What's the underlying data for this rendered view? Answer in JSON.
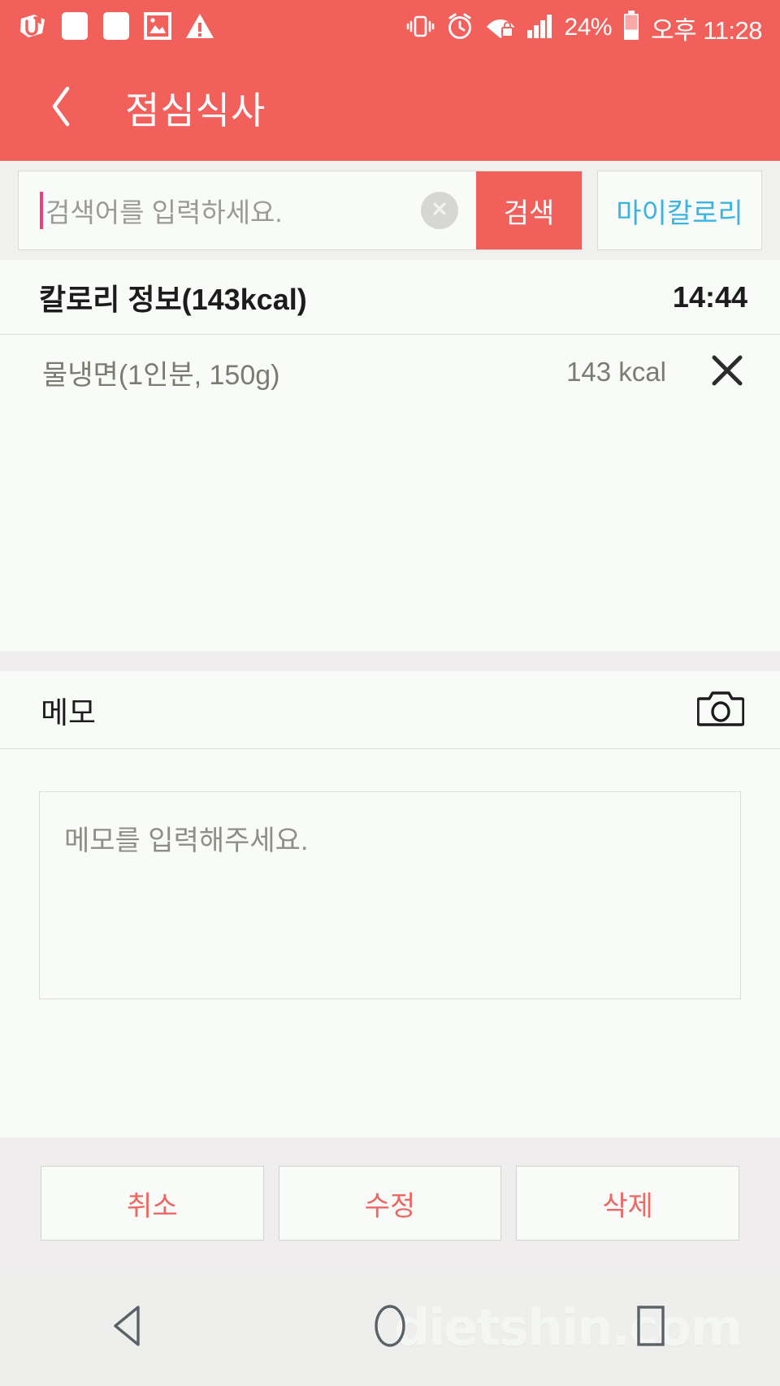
{
  "status_bar": {
    "icons_left": [
      "u-plus-icon",
      "blank-square-icon",
      "blank-square-icon",
      "photo-icon",
      "warning-icon"
    ],
    "icons_right": [
      "vibrate-icon",
      "alarm-icon",
      "wifi-lock-icon",
      "signal-icon"
    ],
    "battery_percent": "24%",
    "clock": "오후 11:28"
  },
  "app_bar": {
    "back_icon": "chevron-left-icon",
    "title": "점심식사"
  },
  "search": {
    "placeholder": "검색어를 입력하세요.",
    "value": "",
    "clear_icon": "clear-circle-icon",
    "search_label": "검색",
    "mycalorie_label": "마이칼로리"
  },
  "calorie": {
    "title": "칼로리 정보(143kcal)",
    "time": "14:44",
    "items": [
      {
        "name": "물냉면(1인분, 150g)",
        "kcal": "143 kcal",
        "delete_icon": "close-x-icon"
      }
    ]
  },
  "memo": {
    "label": "메모",
    "camera_icon": "camera-icon",
    "placeholder": "메모를 입력해주세요.",
    "value": ""
  },
  "actions": {
    "cancel_label": "취소",
    "edit_label": "수정",
    "delete_label": "삭제"
  },
  "nav_bar": {
    "back_icon": "nav-back-triangle-icon",
    "home_icon": "nav-home-circle-icon",
    "recents_icon": "nav-recents-square-icon"
  },
  "watermark": {
    "text": "dietshin.com"
  },
  "colors": {
    "accent_red": "#f2605c",
    "link_blue": "#3bb4e5",
    "action_red": "#ef6763",
    "page_bg": "#f6faf4",
    "panel_bg": "#f8fbf7",
    "band_gray": "#efedee",
    "caret_pink": "#ef3e7c"
  }
}
